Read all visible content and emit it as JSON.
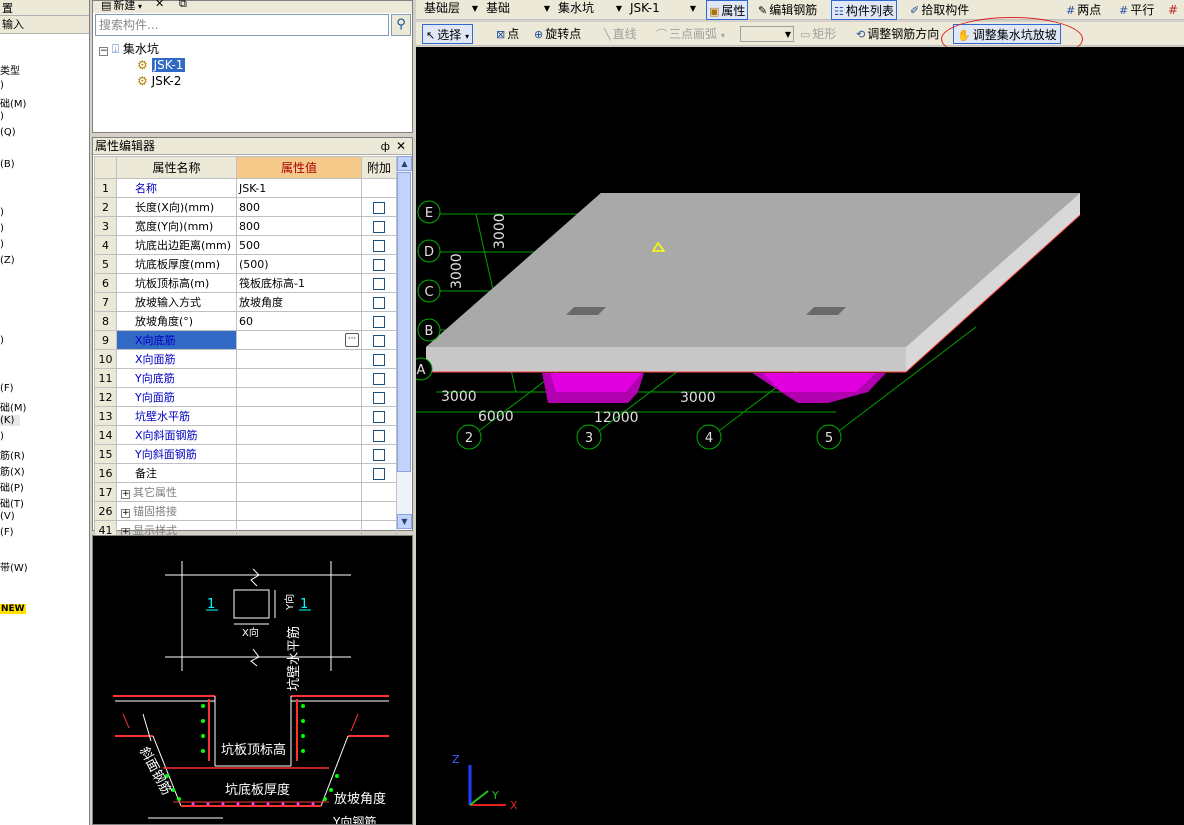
{
  "left_strip": {
    "header1": "置",
    "header2": "输入",
    "items": [
      "类型",
      ")",
      "础(M)",
      ")",
      "(Q)",
      "(B)",
      ")",
      ")",
      ")",
      "(Z)",
      ")",
      "(F)",
      "础(M)",
      "(K)",
      ")",
      "筋(R)",
      "筋(X)",
      "础(P)",
      "础(T)",
      "(V)",
      "(F)",
      "带(W)"
    ],
    "new_badge": "NEW"
  },
  "component_list": {
    "toolbar_new": "新建",
    "search_placeholder": "搜索构件...",
    "tree_root": "集水坑",
    "tree_items": [
      "JSK-1",
      "JSK-2"
    ]
  },
  "property_editor": {
    "title": "属性编辑器",
    "pin": "ф",
    "close": "✕",
    "headers": {
      "name": "属性名称",
      "value": "属性值",
      "extra": "附加"
    },
    "rows": [
      {
        "num": "1",
        "name": "名称",
        "value": "JSK-1",
        "check": false
      },
      {
        "num": "2",
        "name": "长度(X向)(mm)",
        "value": "800",
        "check": true
      },
      {
        "num": "3",
        "name": "宽度(Y向)(mm)",
        "value": "800",
        "check": true
      },
      {
        "num": "4",
        "name": "坑底出边距离(mm)",
        "value": "500",
        "check": true
      },
      {
        "num": "5",
        "name": "坑底板厚度(mm)",
        "value": "(500)",
        "check": true
      },
      {
        "num": "6",
        "name": "坑板顶标高(m)",
        "value": "筏板底标高-1",
        "check": true
      },
      {
        "num": "7",
        "name": "放坡输入方式",
        "value": "放坡角度",
        "check": true
      },
      {
        "num": "8",
        "name": "放坡角度(°)",
        "value": "60",
        "check": true
      },
      {
        "num": "9",
        "name": "X向底筋",
        "value": "",
        "check": true
      },
      {
        "num": "10",
        "name": "X向面筋",
        "value": "",
        "check": true
      },
      {
        "num": "11",
        "name": "Y向底筋",
        "value": "",
        "check": true
      },
      {
        "num": "12",
        "name": "Y向面筋",
        "value": "",
        "check": true
      },
      {
        "num": "13",
        "name": "坑壁水平筋",
        "value": "",
        "check": true
      },
      {
        "num": "14",
        "name": "X向斜面钢筋",
        "value": "",
        "check": true
      },
      {
        "num": "15",
        "name": "Y向斜面钢筋",
        "value": "",
        "check": true
      },
      {
        "num": "16",
        "name": "备注",
        "value": "",
        "check": true
      },
      {
        "num": "17",
        "name": "其它属性",
        "value": "",
        "check": false
      },
      {
        "num": "26",
        "name": "锚固搭接",
        "value": "",
        "check": false
      },
      {
        "num": "41",
        "name": "显示样式",
        "value": "",
        "check": false
      }
    ],
    "ellipsis": "···"
  },
  "preview": {
    "section_mark_left": "1",
    "section_mark_right": "1",
    "y_dir": "Y向",
    "x_dir": "X向",
    "wall_rebar": "坑壁水平筋",
    "top_elev": "坑板顶标高",
    "bottom_thick": "坑底板厚度",
    "slope_angle": "放坡角度",
    "slope_rebar": "斜面钢筋",
    "y_rebar": "Y向钢筋"
  },
  "toolbar1": {
    "layer": "基础层",
    "category": "基础",
    "type": "集水坑",
    "component": "JSK-1",
    "properties": "属性",
    "edit_rebar": "编辑钢筋",
    "component_list": "构件列表",
    "pick_component": "拾取构件",
    "two_points": "两点",
    "parallel": "平行"
  },
  "toolbar2": {
    "select": "选择",
    "point": "点",
    "rotate_point": "旋转点",
    "line": "直线",
    "three_point_arc": "三点画弧",
    "rectangle": "矩形",
    "adjust_rebar_dir": "调整钢筋方向",
    "adjust_slope": "调整集水坑放坡"
  },
  "viewport": {
    "axis_rows": [
      "E",
      "D",
      "C",
      "B",
      "A"
    ],
    "axis_cols": [
      "2",
      "3",
      "4",
      "5"
    ],
    "dims": {
      "d1": "3000",
      "d2": "3000",
      "d3": "3000",
      "d4": "6000",
      "d5": "12000",
      "d6": "3000"
    },
    "triad": {
      "z": "Z",
      "y": "Y",
      "x": "X"
    }
  }
}
